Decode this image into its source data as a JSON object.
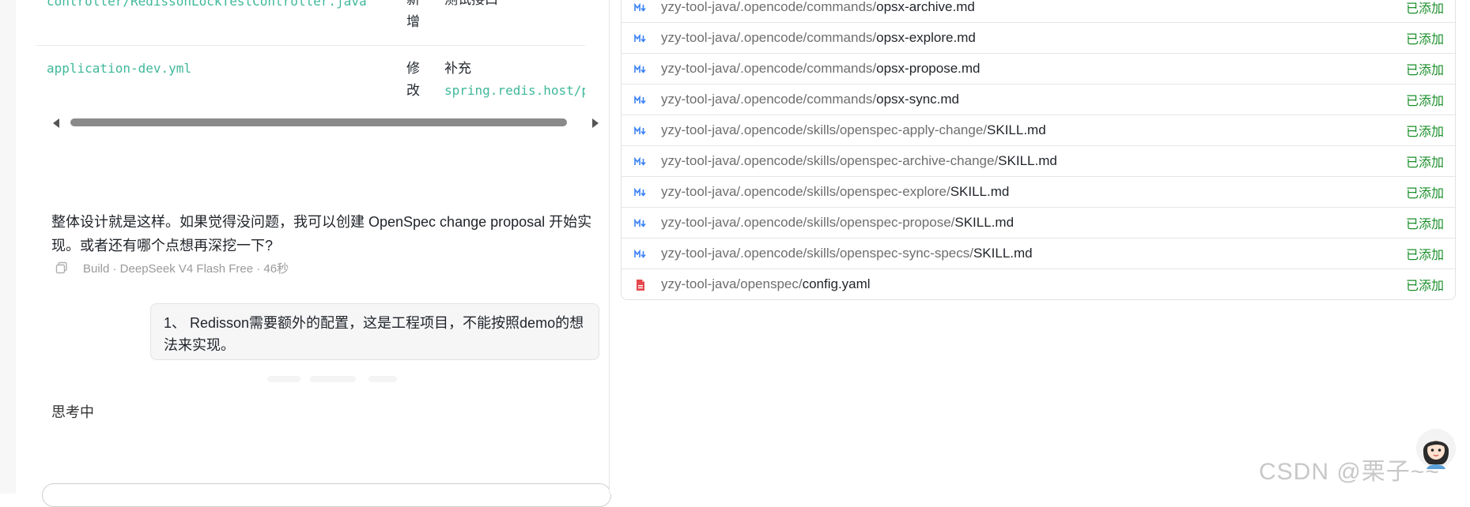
{
  "chat": {
    "file_table": {
      "rows": [
        {
          "path": "controller/RedissonLockTestController.java",
          "action": "新增",
          "desc": "测试接口",
          "desc_code": ""
        },
        {
          "path": "application-dev.yml",
          "action": "修改",
          "desc": "补充",
          "desc_code": "spring.redis.host/por"
        }
      ]
    },
    "summary": "整体设计就是这样。如果觉得没问题，我可以创建 OpenSpec change proposal 开始实现。或者还有哪个点想再深挖一下?",
    "meta": "Build · DeepSeek V4 Flash Free · 46秒",
    "user_message": "1、 Redisson需要额外的配置，这是工程项目，不能按照demo的想法来实现。",
    "thinking": "思考中"
  },
  "files": {
    "items": [
      {
        "icon": "markdown-icon",
        "dir": "yzy-tool-java/.opencode/commands/",
        "name": "opsx-archive.md",
        "status": "已添加"
      },
      {
        "icon": "markdown-icon",
        "dir": "yzy-tool-java/.opencode/commands/",
        "name": "opsx-explore.md",
        "status": "已添加"
      },
      {
        "icon": "markdown-icon",
        "dir": "yzy-tool-java/.opencode/commands/",
        "name": "opsx-propose.md",
        "status": "已添加"
      },
      {
        "icon": "markdown-icon",
        "dir": "yzy-tool-java/.opencode/commands/",
        "name": "opsx-sync.md",
        "status": "已添加"
      },
      {
        "icon": "markdown-icon",
        "dir": "yzy-tool-java/.opencode/skills/openspec-apply-change/",
        "name": "SKILL.md",
        "status": "已添加"
      },
      {
        "icon": "markdown-icon",
        "dir": "yzy-tool-java/.opencode/skills/openspec-archive-change/",
        "name": "SKILL.md",
        "status": "已添加"
      },
      {
        "icon": "markdown-icon",
        "dir": "yzy-tool-java/.opencode/skills/openspec-explore/",
        "name": "SKILL.md",
        "status": "已添加"
      },
      {
        "icon": "markdown-icon",
        "dir": "yzy-tool-java/.opencode/skills/openspec-propose/",
        "name": "SKILL.md",
        "status": "已添加"
      },
      {
        "icon": "markdown-icon",
        "dir": "yzy-tool-java/.opencode/skills/openspec-sync-specs/",
        "name": "SKILL.md",
        "status": "已添加"
      },
      {
        "icon": "yaml-file-icon",
        "dir": "yzy-tool-java/openspec/",
        "name": "config.yaml",
        "status": "已添加"
      }
    ]
  },
  "watermark": "CSDN @栗子~~",
  "colors": {
    "code_accent": "#3fb89a",
    "status_added": "#1a8f2a",
    "markdown_icon": "#3b82f6",
    "yaml_icon": "#e5484d"
  }
}
